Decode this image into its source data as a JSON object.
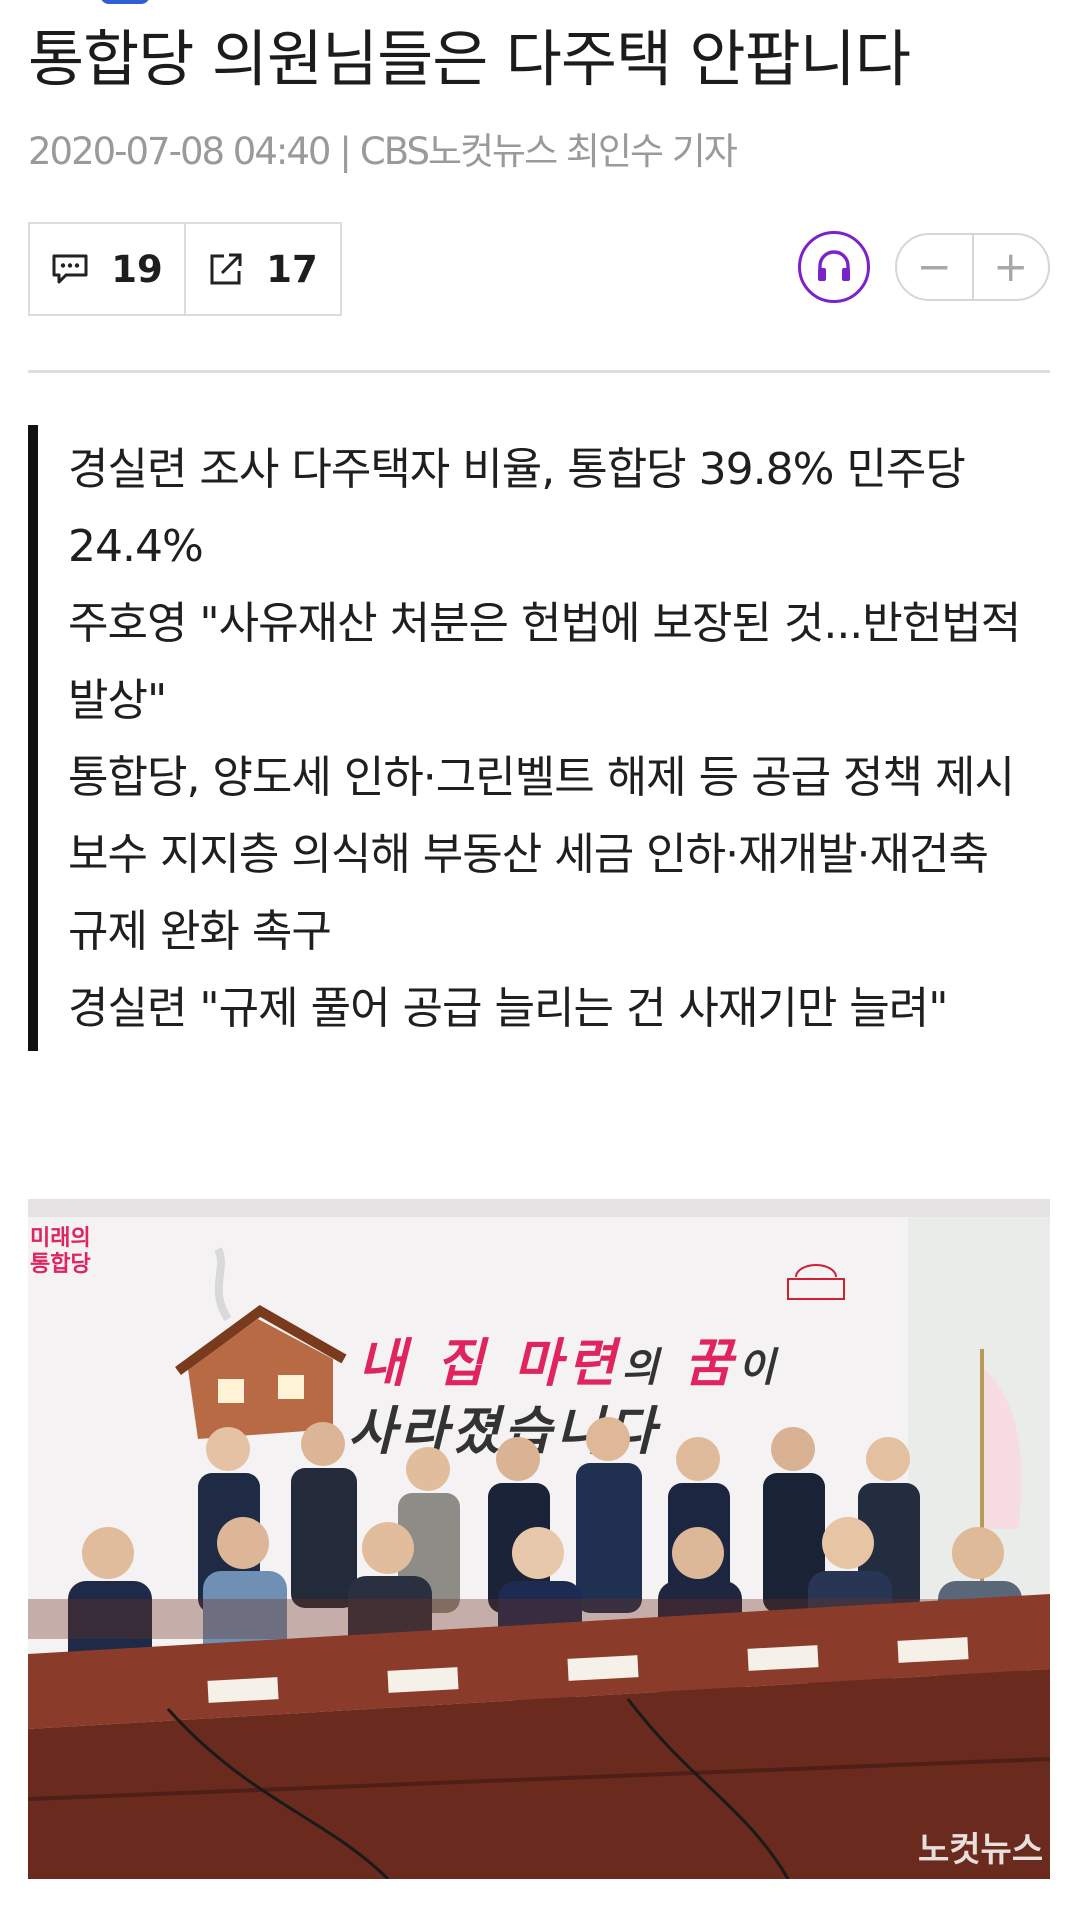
{
  "article": {
    "headline": "통합당 의원님들은 다주택 안팝니다",
    "date": "2020-07-08 04:40",
    "separator": "|",
    "byline": "CBS노컷뉴스 최인수 기자"
  },
  "toolbar": {
    "comment_icon": "comment-icon",
    "comment_count": "19",
    "share_icon": "share-icon",
    "share_count": "17",
    "listen_icon": "headphones-icon",
    "font_decrease": "−",
    "font_increase": "+"
  },
  "summary": [
    "경실련 조사 다주택자 비율, 통합당 39.8% 민주당 24.4%",
    "주호영 \"사유재산 처분은 헌법에 보장된 것...반헌법적 발상\"",
    "통합당, 양도세 인하·그린벨트 해제 등 공급 정책 제시",
    "보수 지지층 의식해 부동산 세금 인하·재개발·재건축 규제 완화 촉구",
    "경실련 \"규제 풀어 공급 늘리는 건 사재기만 늘려\""
  ],
  "photo": {
    "party_logo_line1": "미래의",
    "party_logo_line2": "통합당",
    "banner_part1": "내 집 마련",
    "banner_part2": "의 ",
    "banner_part3": "꿈",
    "banner_part4": "이",
    "banner_line2": "사라졌습니다",
    "watermark": "노컷뉴스"
  },
  "colors": {
    "accent_purple": "#7b22c9",
    "banner_pink": "#e0245e",
    "tab_blue": "#2f5fd0"
  }
}
